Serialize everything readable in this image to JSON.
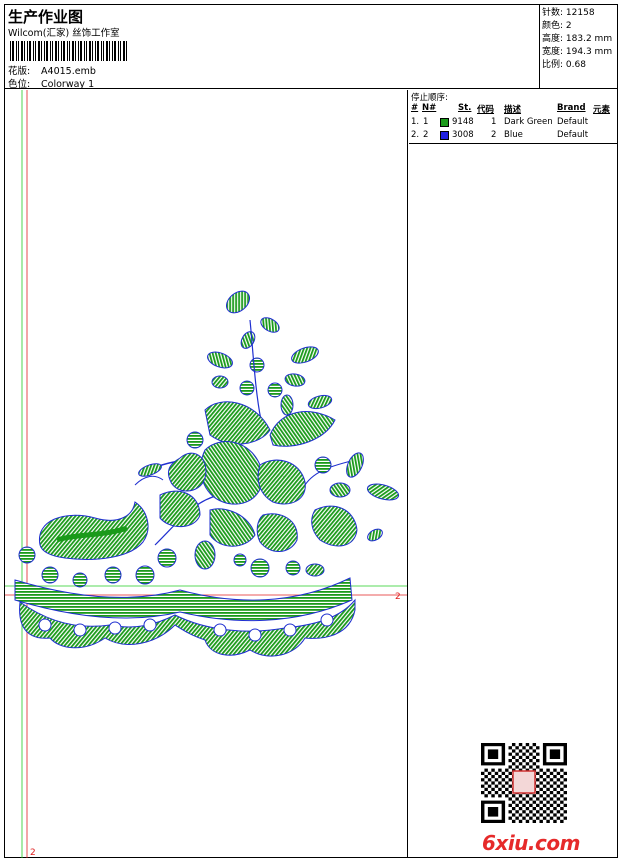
{
  "header": {
    "title": "生产作业图",
    "subtitle": "Wilcom(汇家) 丝饰工作室",
    "file_label": "花版:",
    "file_value": "A4015.emb",
    "color_label": "色位:",
    "color_value": "Colorway 1"
  },
  "stats": [
    {
      "label": "针数:",
      "value": "12158"
    },
    {
      "label": "颜色:",
      "value": "2"
    },
    {
      "label": "高度:",
      "value": "183.2 mm"
    },
    {
      "label": "宽度:",
      "value": "194.3 mm"
    },
    {
      "label": "比例:",
      "value": "0.68"
    }
  ],
  "sequence": {
    "title": "停止顺序:",
    "headers": [
      "#",
      "N#",
      "St.",
      "代码",
      "描述",
      "Brand",
      "元素"
    ],
    "rows": [
      {
        "index": "1.",
        "n": "1",
        "st": "9148",
        "code": "1",
        "desc": "Dark Green",
        "brand": "Default",
        "color": "#1a9a1a"
      },
      {
        "index": "2.",
        "n": "2",
        "st": "3008",
        "code": "2",
        "desc": "Blue",
        "brand": "Default",
        "color": "#1f1fe0"
      }
    ]
  },
  "design": {
    "guide_right_label": "2",
    "guide_bottom_label": "2",
    "thread_green": "#1a9a1a",
    "thread_blue": "#1f2fd0",
    "guide_red": "#e02020",
    "guide_green": "#22cc22"
  },
  "watermark": "6xiu.com"
}
